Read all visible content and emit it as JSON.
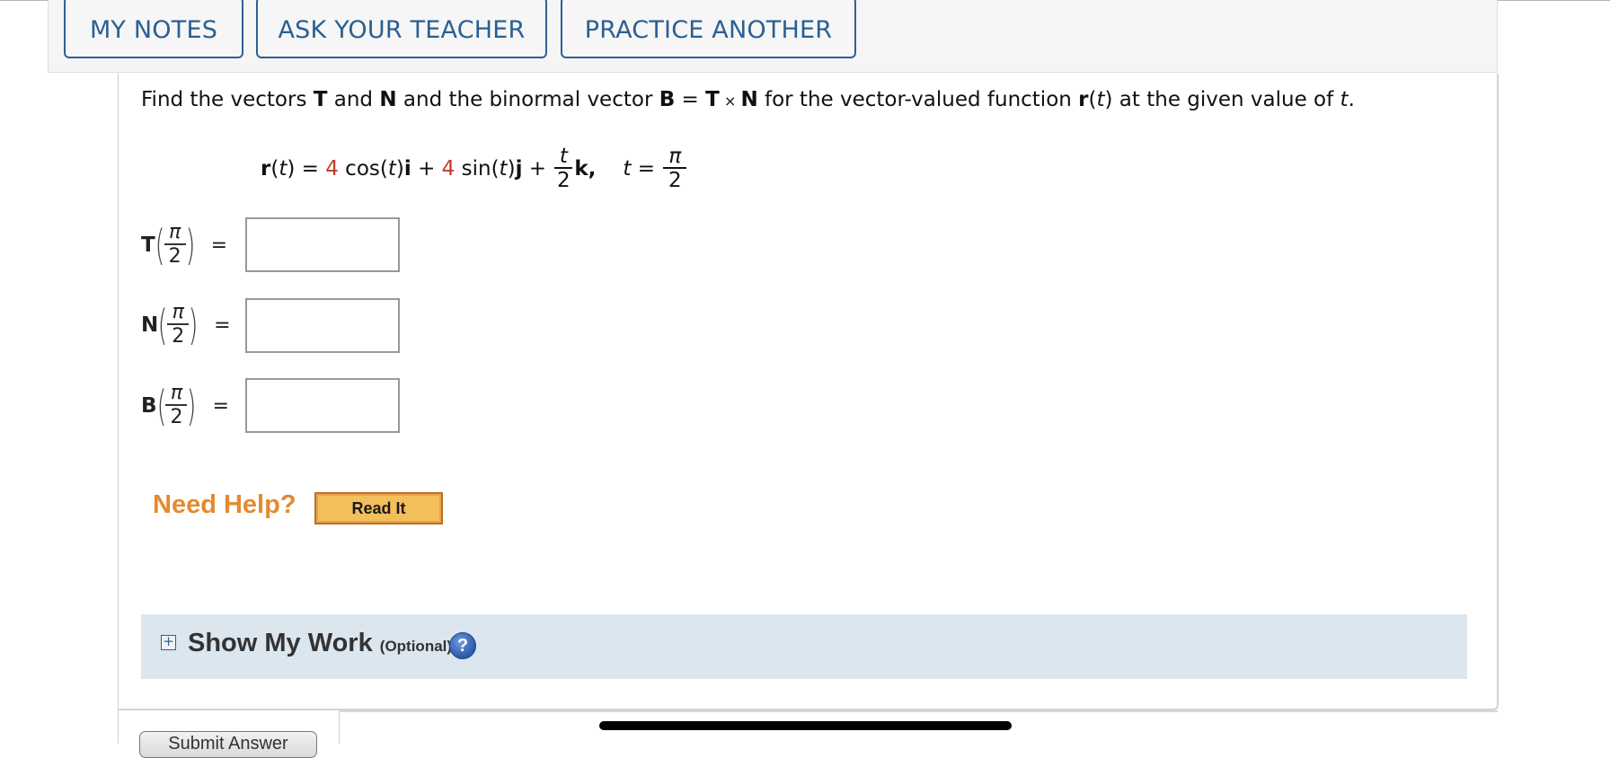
{
  "toolbar": {
    "buttons": [
      {
        "label": "MY NOTES"
      },
      {
        "label": "ASK YOUR TEACHER"
      },
      {
        "label": "PRACTICE ANOTHER"
      }
    ]
  },
  "question": {
    "p1": "Find the vectors ",
    "T": "T",
    "p2": " and ",
    "N": "N",
    "p3": " and the binormal vector ",
    "B": "B",
    "p4": " = ",
    "T2": "T",
    "times": " × ",
    "N2": "N",
    "p5": " for the vector-valued function ",
    "r": "r",
    "p6": "(",
    "t": "t",
    "p7": ") at the given value of ",
    "t2": "t",
    "p8": "."
  },
  "formula": {
    "r": "r",
    "lp": "(",
    "t": "t",
    "rp_eq": ") = ",
    "coef1": "4",
    "cos": " cos(",
    "t1": "t",
    "cos_end": ")",
    "i": "i",
    "plus1": " + ",
    "coef2": "4",
    "sin": " sin(",
    "t2": "t",
    "sin_end": ")",
    "j": "j",
    "plus2": " + ",
    "frac_num": "t",
    "frac_den": "2",
    "k": "k,",
    "tvar": "t",
    "teq": " = ",
    "tval_num": "π",
    "tval_den": "2"
  },
  "answers": [
    {
      "label": "T",
      "arg_num": "π",
      "arg_den": "2",
      "eq": "=",
      "value": ""
    },
    {
      "label": "N",
      "arg_num": "π",
      "arg_den": "2",
      "eq": "=",
      "value": ""
    },
    {
      "label": "B",
      "arg_num": "π",
      "arg_den": "2",
      "eq": "=",
      "value": ""
    }
  ],
  "help": {
    "label": "Need Help?",
    "read_it": "Read It"
  },
  "show_my_work": {
    "toggle": "+",
    "title": "Show My Work",
    "optional": "(Optional)",
    "help_icon": "?"
  },
  "submit": {
    "label": "Submit Answer"
  },
  "colors": {
    "accent_blue": "#2f6193",
    "help_orange": "#e48a2f",
    "coefficient_red": "#c0392b",
    "show_work_bg": "#dce6ef"
  }
}
